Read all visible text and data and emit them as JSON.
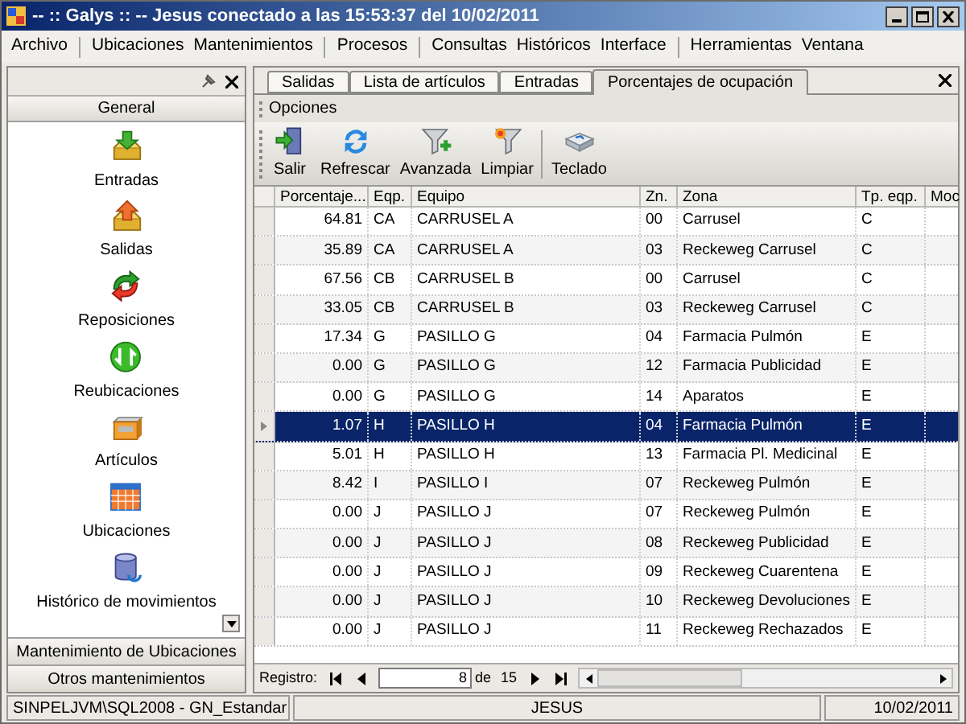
{
  "window": {
    "title": "-- :: Galys :: -- Jesus conectado a las 15:53:37 del 10/02/2011"
  },
  "menu": [
    [
      "Archivo"
    ],
    [
      "Ubicaciones",
      "Mantenimientos"
    ],
    [
      "Procesos"
    ],
    [
      "Consultas",
      "Históricos",
      "Interface"
    ],
    [
      "Herramientas",
      "Ventana"
    ]
  ],
  "sidebar": {
    "group": "General",
    "items": [
      {
        "label": "Entradas",
        "kind": "in"
      },
      {
        "label": "Salidas",
        "kind": "out"
      },
      {
        "label": "Reposiciones",
        "kind": "repo"
      },
      {
        "label": "Reubicaciones",
        "kind": "reub"
      },
      {
        "label": "Artículos",
        "kind": "art"
      },
      {
        "label": "Ubicaciones",
        "kind": "grid"
      },
      {
        "label": "Histórico de movimientos",
        "kind": "db"
      }
    ],
    "bottom_groups": [
      "Mantenimiento de Ubicaciones",
      "Otros mantenimientos"
    ]
  },
  "tabs": [
    {
      "label": "Salidas",
      "selected": false
    },
    {
      "label": "Lista de artículos",
      "selected": false
    },
    {
      "label": "Entradas",
      "selected": false
    },
    {
      "label": "Porcentajes de ocupación",
      "selected": true
    }
  ],
  "options_label": "Opciones",
  "toolbar": [
    {
      "label": "Salir",
      "kind": "exit"
    },
    {
      "label": "Refrescar",
      "kind": "refresh"
    },
    {
      "label": "Avanzada",
      "kind": "filter_add"
    },
    {
      "label": "Limpiar",
      "kind": "filter_clear"
    },
    {
      "label": "Teclado",
      "kind": "keyboard"
    }
  ],
  "table": {
    "columns": [
      "Porcentaje...",
      "Eqp.",
      "Equipo",
      "Zn.",
      "Zona",
      "Tp. eqp.",
      "Moc"
    ],
    "rows": [
      {
        "cells": [
          "64.81",
          "CA",
          "CARRUSEL A",
          "00",
          "Carrusel",
          "C"
        ],
        "selected": false
      },
      {
        "cells": [
          "35.89",
          "CA",
          "CARRUSEL A",
          "03",
          "Reckeweg Carrusel",
          "C"
        ],
        "selected": false
      },
      {
        "cells": [
          "67.56",
          "CB",
          "CARRUSEL B",
          "00",
          "Carrusel",
          "C"
        ],
        "selected": false
      },
      {
        "cells": [
          "33.05",
          "CB",
          "CARRUSEL B",
          "03",
          "Reckeweg Carrusel",
          "C"
        ],
        "selected": false
      },
      {
        "cells": [
          "17.34",
          "G",
          "PASILLO G",
          "04",
          "Farmacia Pulmón",
          "E"
        ],
        "selected": false
      },
      {
        "cells": [
          "0.00",
          "G",
          "PASILLO G",
          "12",
          "Farmacia Publicidad",
          "E"
        ],
        "selected": false
      },
      {
        "cells": [
          "0.00",
          "G",
          "PASILLO G",
          "14",
          "Aparatos",
          "E"
        ],
        "selected": false
      },
      {
        "cells": [
          "1.07",
          "H",
          "PASILLO H",
          "04",
          "Farmacia Pulmón",
          "E"
        ],
        "selected": true
      },
      {
        "cells": [
          "5.01",
          "H",
          "PASILLO H",
          "13",
          "Farmacia Pl. Medicinal",
          "E"
        ],
        "selected": false
      },
      {
        "cells": [
          "8.42",
          "I",
          "PASILLO I",
          "07",
          "Reckeweg Pulmón",
          "E"
        ],
        "selected": false
      },
      {
        "cells": [
          "0.00",
          "J",
          "PASILLO J",
          "07",
          "Reckeweg Pulmón",
          "E"
        ],
        "selected": false
      },
      {
        "cells": [
          "0.00",
          "J",
          "PASILLO J",
          "08",
          "Reckeweg Publicidad",
          "E"
        ],
        "selected": false
      },
      {
        "cells": [
          "0.00",
          "J",
          "PASILLO J",
          "09",
          "Reckeweg Cuarentena",
          "E"
        ],
        "selected": false
      },
      {
        "cells": [
          "0.00",
          "J",
          "PASILLO J",
          "10",
          "Reckeweg Devoluciones",
          "E"
        ],
        "selected": false
      },
      {
        "cells": [
          "0.00",
          "J",
          "PASILLO J",
          "11",
          "Reckeweg Rechazados",
          "E"
        ],
        "selected": false
      }
    ]
  },
  "navigator": {
    "label": "Registro:",
    "current": "8",
    "of": "de",
    "total": "15"
  },
  "status_bar": [
    "SINPELJVM\\SQL2008 - GN_Estandar",
    "JESUS",
    "10/02/2011"
  ]
}
